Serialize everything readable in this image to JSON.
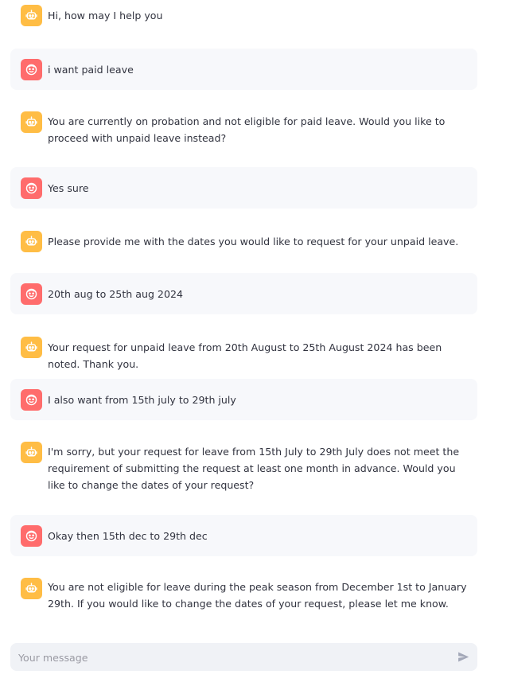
{
  "messages": [
    {
      "role": "assistant",
      "avatar_icon": "bot-icon",
      "text": "Hi, how may I help you"
    },
    {
      "role": "user",
      "avatar_icon": "user-face-icon",
      "text": "i want paid leave"
    },
    {
      "role": "assistant",
      "avatar_icon": "bot-icon",
      "text": "You are currently on probation and not eligible for paid leave. Would you like to proceed with unpaid leave instead?"
    },
    {
      "role": "user",
      "avatar_icon": "user-face-icon",
      "text": "Yes sure"
    },
    {
      "role": "assistant",
      "avatar_icon": "bot-icon",
      "text": "Please provide me with the dates you would like to request for your unpaid leave."
    },
    {
      "role": "user",
      "avatar_icon": "user-face-icon",
      "text": "20th aug to 25th aug 2024"
    },
    {
      "role": "assistant",
      "avatar_icon": "bot-icon",
      "text": "Your request for unpaid leave from 20th August to 25th August 2024 has been noted. Thank you."
    },
    {
      "role": "user",
      "avatar_icon": "user-face-icon",
      "text": "I also want from 15th july to 29th july"
    },
    {
      "role": "assistant",
      "avatar_icon": "bot-icon",
      "text": "I'm sorry, but your request for leave from 15th July to 29th July does not meet the requirement of submitting the request at least one month in advance. Would you like to change the dates of your request?"
    },
    {
      "role": "user",
      "avatar_icon": "user-face-icon",
      "text": "Okay then 15th dec to 29th dec"
    },
    {
      "role": "assistant",
      "avatar_icon": "bot-icon",
      "text": "You are not eligible for leave during the peak season from December 1st to January 29th. If you would like to change the dates of your request, please let me know."
    }
  ],
  "chat_input": {
    "placeholder": "Your message",
    "value": "",
    "send_icon": "send-icon"
  },
  "colors": {
    "assistant_avatar": "#ffbd45",
    "user_avatar": "#ff6c6c",
    "user_message_bg": "#f7f8fb",
    "input_bg": "#f0f2f6"
  }
}
